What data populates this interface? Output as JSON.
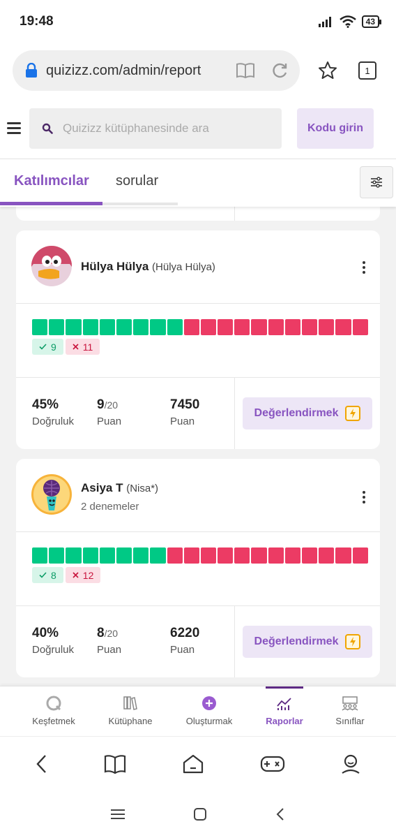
{
  "status": {
    "time": "19:48",
    "battery": "43"
  },
  "browser": {
    "url": "quizizz.com/admin/report",
    "tab_count": "1"
  },
  "header": {
    "search_placeholder": "Quizizz kütüphanesinde ara",
    "code_button": "Kodu girin"
  },
  "tabs": [
    {
      "label": "Katılımcılar",
      "active": true
    },
    {
      "label": "sorular",
      "active": false
    }
  ],
  "participants": [
    {
      "name": "Hülya Hülya",
      "alias": "(Hülya Hülya)",
      "attempts": "",
      "correct": 9,
      "incorrect": 11,
      "correct_label": "9",
      "incorrect_label": "11",
      "accuracy": "45%",
      "accuracy_label": "Doğruluk",
      "score": "9",
      "score_total": "/20",
      "score_label": "Puan",
      "points": "7450",
      "points_label": "Puan",
      "eval_button": "Değerlendirmek"
    },
    {
      "name": "Asiya T",
      "alias": "(Nisa*)",
      "attempts": "2 denemeler",
      "correct": 8,
      "incorrect": 12,
      "correct_label": "8",
      "incorrect_label": "12",
      "accuracy": "40%",
      "accuracy_label": "Doğruluk",
      "score": "8",
      "score_total": "/20",
      "score_label": "Puan",
      "points": "6220",
      "points_label": "Puan",
      "eval_button": "Değerlendirmek"
    }
  ],
  "colors": {
    "accent": "#8854c0",
    "correct": "#00c985",
    "incorrect": "#ec3b64"
  },
  "app_nav": [
    {
      "label": "Keşfetmek",
      "icon": "explore-icon"
    },
    {
      "label": "Kütüphane",
      "icon": "library-icon"
    },
    {
      "label": "Oluşturmak",
      "icon": "create-plus-icon"
    },
    {
      "label": "Raporlar",
      "icon": "reports-icon",
      "active": true
    },
    {
      "label": "Sınıflar",
      "icon": "classes-icon"
    }
  ]
}
